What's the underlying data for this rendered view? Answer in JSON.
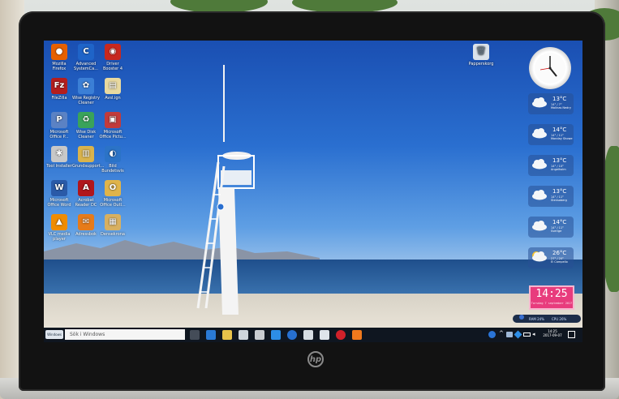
{
  "desktop": {
    "icons": [
      {
        "label": "Mozilla Firefox",
        "color": "#e66000",
        "glyph": "●"
      },
      {
        "label": "Advanced SystemCa...",
        "color": "#1f64c8",
        "glyph": "C"
      },
      {
        "label": "Driver Booster 4",
        "color": "#c8281e",
        "glyph": "◉"
      },
      {
        "label": "FileZilla",
        "color": "#b41e1e",
        "glyph": "Fz"
      },
      {
        "label": "Wise Registry Cleaner",
        "color": "#3b7fd6",
        "glyph": "✿"
      },
      {
        "label": "Avsl.ign",
        "color": "#e8d9a0",
        "glyph": "▤"
      },
      {
        "label": "Microsoft Office P...",
        "color": "#5b82c4",
        "glyph": "P"
      },
      {
        "label": "Wise Disk Cleaner",
        "color": "#3aa35a",
        "glyph": "♻"
      },
      {
        "label": "Microsoft Office Pictu...",
        "color": "#c23b3b",
        "glyph": "▣"
      },
      {
        "label": "Tool Installer",
        "color": "#c8c8c8",
        "glyph": "✱"
      },
      {
        "label": "Grundsupport...",
        "color": "#d9b34c",
        "glyph": "▥"
      },
      {
        "label": "Bild Bundetsvis",
        "color": "#2b73c7",
        "glyph": "◐"
      },
      {
        "label": "Microsoft Office Word",
        "color": "#2a5aa8",
        "glyph": "W"
      },
      {
        "label": "Acrobat Reader DC",
        "color": "#b0161c",
        "glyph": "A"
      },
      {
        "label": "Microsoft Office Outl...",
        "color": "#e0b44a",
        "glyph": "O"
      },
      {
        "label": "VLC media player",
        "color": "#f08c00",
        "glyph": "▲"
      },
      {
        "label": "Adressbok",
        "color": "#e67b1a",
        "glyph": "✉"
      },
      {
        "label": "Densekrona",
        "color": "#d8b060",
        "glyph": "▦"
      }
    ],
    "recycle_bin": {
      "label": "Papperskorg"
    }
  },
  "gadgets": {
    "weather": [
      {
        "temp": "13°C",
        "range": "14° / 7°",
        "place": "Molinas Nedry"
      },
      {
        "temp": "14°C",
        "range": "14° / 11°",
        "place": "Monday Showe"
      },
      {
        "temp": "13°C",
        "range": "14° / 10°",
        "place": "Angelholm"
      },
      {
        "temp": "13°C",
        "range": "14° / 11°",
        "place": "Stensoberg"
      },
      {
        "temp": "14°C",
        "range": "14° / 11°",
        "place": "Sverige"
      },
      {
        "temp": "26°C",
        "range": "27° / 20°",
        "place": "El Campello"
      }
    ],
    "digital_clock": {
      "time": "14:25",
      "date": "Torsdag 7 september 2017"
    },
    "meter": {
      "ram": "RAM 24%",
      "cpu": "CPU 26%"
    }
  },
  "taskbar": {
    "search_placeholder": "Sök i Windows",
    "start_label": "Windows",
    "clock_time": "14:25",
    "clock_date": "2017-09-07",
    "pinned": [
      {
        "name": "task-view-icon",
        "color": "#444c58"
      },
      {
        "name": "edge-icon",
        "color": "#2a7ad6"
      },
      {
        "name": "file-explorer-icon",
        "color": "#e8c24a"
      },
      {
        "name": "store-icon",
        "color": "#cfd6dc"
      },
      {
        "name": "calculator-icon",
        "color": "#c9cdd2"
      },
      {
        "name": "dropbox-icon",
        "color": "#2d8ee6"
      },
      {
        "name": "advanced-systemcare-icon",
        "color": "#2770d0"
      },
      {
        "name": "messaging-icon",
        "color": "#d6dde3"
      },
      {
        "name": "mail-icon",
        "color": "#dfe4ea"
      },
      {
        "name": "opera-icon",
        "color": "#d0212a"
      },
      {
        "name": "app-icon",
        "color": "#f0791d"
      }
    ]
  }
}
